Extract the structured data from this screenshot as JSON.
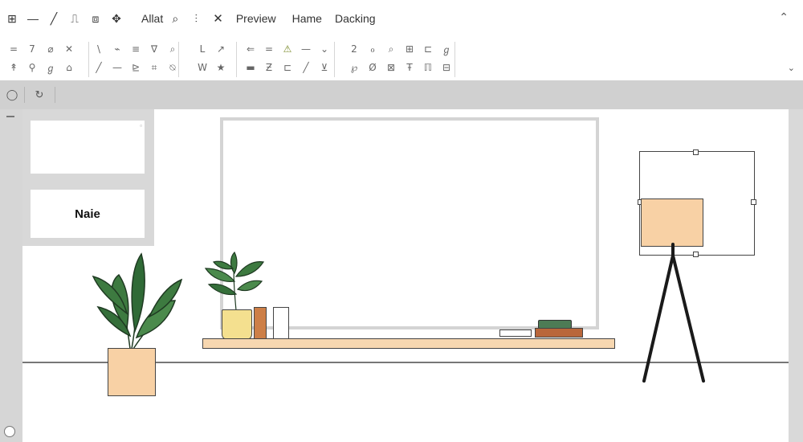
{
  "menubar": {
    "icons": [
      "layout-icon",
      "minus-icon",
      "pen-icon",
      "bookmark-icon",
      "frame-icon",
      "move-icon"
    ],
    "items": [
      {
        "name": "menu-allat",
        "label": "Allat"
      },
      {
        "name": "menu-preview",
        "label": "Preview"
      },
      {
        "name": "menu-hame",
        "label": "Hame"
      },
      {
        "name": "menu-dacking",
        "label": "Dacking"
      }
    ]
  },
  "ribbon": {
    "row1": [
      "=",
      "7",
      "⌀",
      "✕",
      "\\",
      "⌁",
      "≡",
      "∇",
      "⌕",
      "ᒪ",
      "↗",
      "⇐",
      "=",
      "⚠",
      "—",
      "⌄",
      "2",
      "ℴ",
      "⌕",
      "⊞",
      "⊏",
      "ℊ"
    ],
    "row2": [
      "↟",
      "⚲",
      "ℊ",
      "⌂",
      "╱",
      "—",
      "⊵",
      "⌗",
      "⍉",
      "W",
      "★",
      "▬",
      "Ƶ",
      "⊏",
      "╱",
      "⊻",
      "℘",
      "Ø",
      "⊠",
      "Ŧ",
      "ℿ",
      "⊟"
    ],
    "warning_color": "#7a8a2a"
  },
  "thumbnails": {
    "second_label": "Naie"
  },
  "colors": {
    "shade": "#f8d1a5",
    "pot": "#f8d1a5",
    "shelf": "#f7d7b0",
    "leaf": "#3d7a40",
    "small_pot": "#f4e08f",
    "book_orange": "#cd7f47",
    "book_green": "#4d7b55",
    "book_brown": "#b9663a"
  }
}
